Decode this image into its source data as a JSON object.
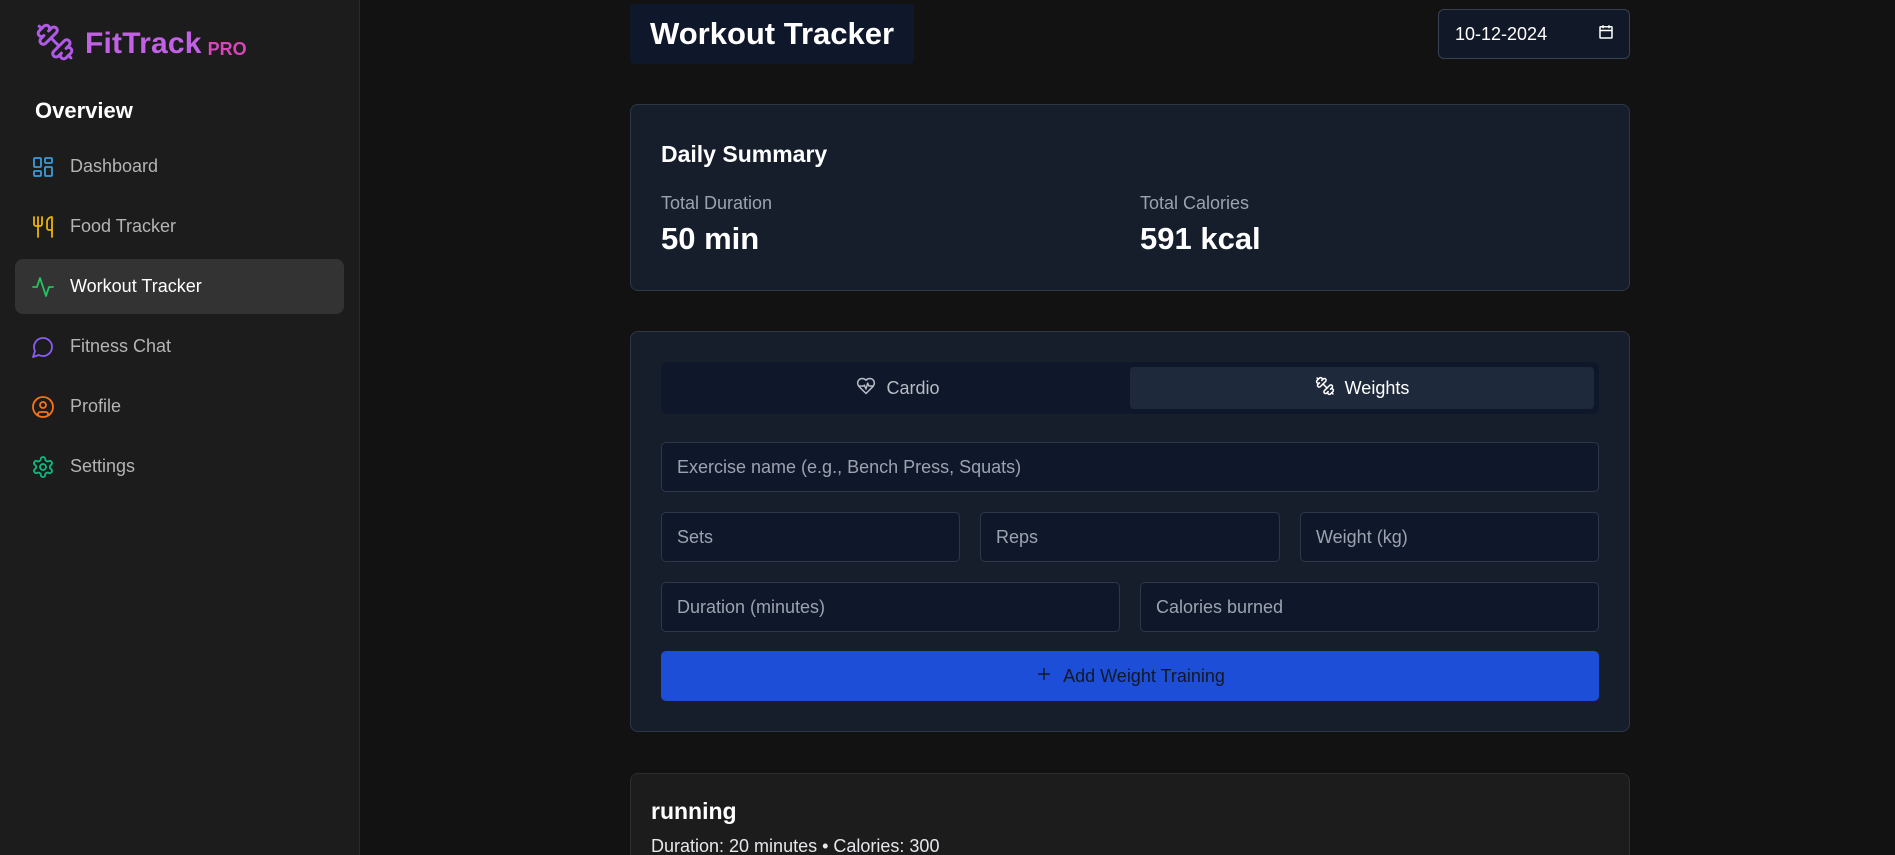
{
  "app": {
    "logo_text": "FitTrack",
    "logo_badge": "PRO",
    "logo_icon": "dumbbell-icon"
  },
  "sidebar": {
    "heading": "Overview",
    "items": [
      {
        "label": "Dashboard",
        "icon": "dashboard-grid-icon",
        "color": "#3b9bd9",
        "active": false
      },
      {
        "label": "Food Tracker",
        "icon": "utensils-icon",
        "color": "#eab308",
        "active": false
      },
      {
        "label": "Workout Tracker",
        "icon": "activity-icon",
        "color": "#22c55e",
        "active": true
      },
      {
        "label": "Fitness Chat",
        "icon": "chat-bubble-icon",
        "color": "#8b5cf6",
        "active": false
      },
      {
        "label": "Profile",
        "icon": "user-circle-icon",
        "color": "#f97316",
        "active": false
      },
      {
        "label": "Settings",
        "icon": "gear-icon",
        "color": "#10b981",
        "active": false
      }
    ]
  },
  "header": {
    "title": "Workout Tracker",
    "date_value": "10-12-2024"
  },
  "summary": {
    "title": "Daily Summary",
    "duration_label": "Total Duration",
    "duration_value": "50 min",
    "calories_label": "Total Calories",
    "calories_value": "591 kcal"
  },
  "form": {
    "tabs": [
      {
        "label": "Cardio",
        "icon": "heart-pulse-icon",
        "active": false
      },
      {
        "label": "Weights",
        "icon": "dumbbell-icon",
        "active": true
      }
    ],
    "exercise_placeholder": "Exercise name (e.g., Bench Press, Squats)",
    "sets_placeholder": "Sets",
    "reps_placeholder": "Reps",
    "weight_placeholder": "Weight (kg)",
    "duration_placeholder": "Duration (minutes)",
    "calories_placeholder": "Calories burned",
    "submit_label": "Add Weight Training"
  },
  "entries": [
    {
      "name": "running",
      "meta": "Duration: 20 minutes • Calories: 300"
    }
  ],
  "colors": {
    "accent_blue": "#1d4ed8",
    "logo_purple": "#c261e6",
    "logo_pink": "#d946b8"
  }
}
